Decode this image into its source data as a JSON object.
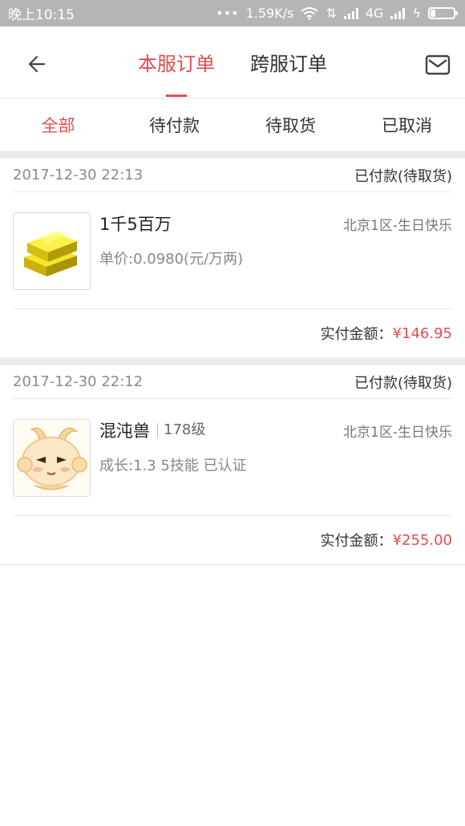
{
  "status_bar": {
    "time": "晚上10:15",
    "net_speed": "1.59K/s",
    "network": "4G"
  },
  "header": {
    "back_icon": "back-arrow-icon",
    "mail_icon": "mail-icon",
    "tabs": [
      {
        "label": "本服订单",
        "active": true
      },
      {
        "label": "跨服订单",
        "active": false
      }
    ]
  },
  "filters": [
    {
      "label": "全部",
      "active": true
    },
    {
      "label": "待付款",
      "active": false
    },
    {
      "label": "待取货",
      "active": false
    },
    {
      "label": "已取消",
      "active": false
    }
  ],
  "colors": {
    "accent": "#e34c4c",
    "status_bar": "#b5b5b5",
    "divider": "#ececec"
  },
  "orders": [
    {
      "date": "2017-12-30 22:13",
      "status": "已付款(待取货)",
      "image": "gold-bars-icon",
      "name": "1千5百万",
      "level": "",
      "server": "北京1区-生日快乐",
      "detail": "单价:0.0980(元/万两)",
      "paid_label": "实付金额：",
      "paid_amount": "¥146.95"
    },
    {
      "date": "2017-12-30 22:12",
      "status": "已付款(待取货)",
      "image": "pet-creature-icon",
      "name": "混沌兽",
      "level": "178级",
      "server": "北京1区-生日快乐",
      "detail": "成长:1.3 5技能 已认证",
      "paid_label": "实付金额：",
      "paid_amount": "¥255.00"
    }
  ]
}
